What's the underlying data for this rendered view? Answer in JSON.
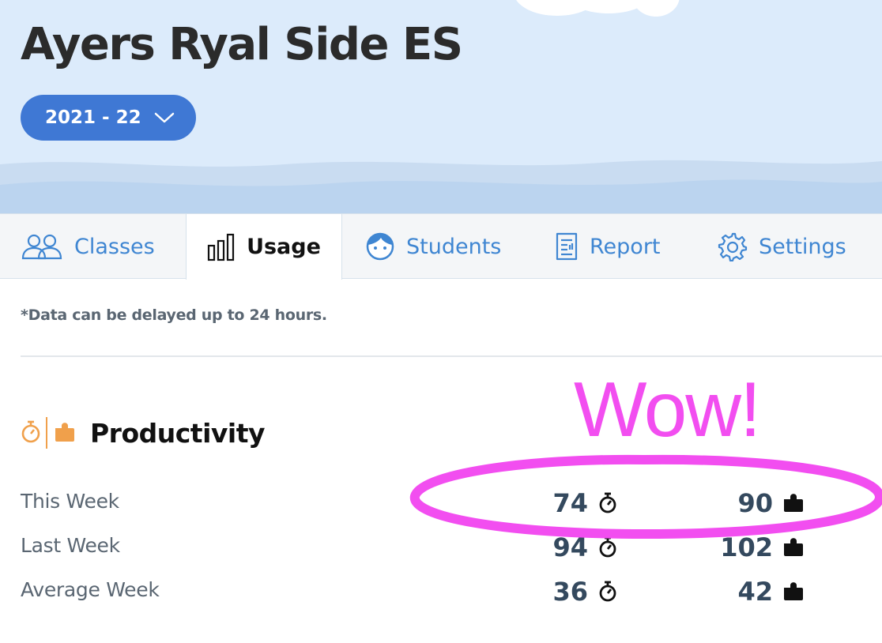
{
  "header": {
    "school_name": "Ayers Ryal Side ES",
    "year_selected": "2021 - 22"
  },
  "tabs": [
    {
      "label": "Classes",
      "icon": "users-icon"
    },
    {
      "label": "Usage",
      "icon": "bar-chart-icon",
      "active": true
    },
    {
      "label": "Students",
      "icon": "student-face-icon"
    },
    {
      "label": "Report",
      "icon": "report-icon"
    },
    {
      "label": "Settings",
      "icon": "gear-icon"
    }
  ],
  "note": "*Data can be delayed up to 24 hours.",
  "productivity": {
    "title": "Productivity",
    "rows": [
      {
        "label": "This Week",
        "minutes": "74",
        "puzzles": "90"
      },
      {
        "label": "Last Week",
        "minutes": "94",
        "puzzles": "102"
      },
      {
        "label": "Average Week",
        "minutes": "36",
        "puzzles": "42"
      }
    ]
  },
  "annotation": {
    "text": "Wow!",
    "color": "#f24ef0"
  },
  "colors": {
    "header_bg": "#dcebfb",
    "accent_blue": "#3f78d4",
    "tab_blue": "#3f86d2",
    "productivity_orange": "#f0a04b",
    "value_text": "#34495e"
  }
}
